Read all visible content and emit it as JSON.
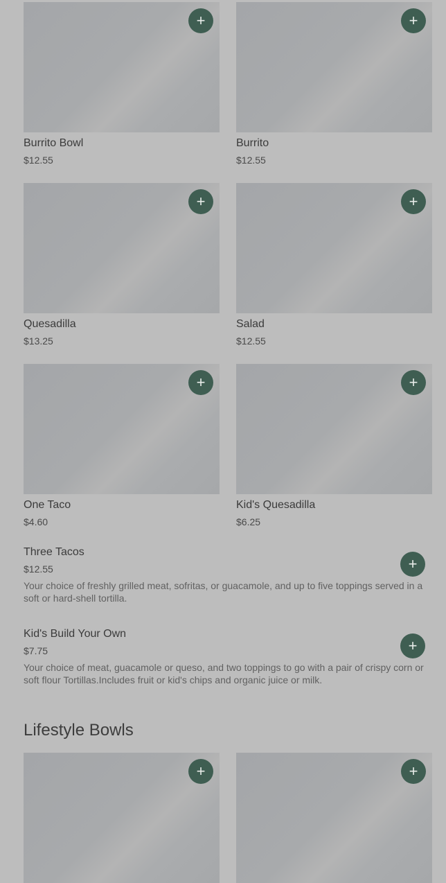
{
  "add_icon": "plus-icon",
  "accent_color": "#3f5e52",
  "grid_rows": [
    [
      {
        "name": "Burrito Bowl",
        "price": "$12.55"
      },
      {
        "name": "Burrito",
        "price": "$12.55"
      }
    ],
    [
      {
        "name": "Quesadilla",
        "price": "$13.25"
      },
      {
        "name": "Salad",
        "price": "$12.55"
      }
    ],
    [
      {
        "name": "One Taco",
        "price": "$4.60"
      },
      {
        "name": "Kid's Quesadilla",
        "price": "$6.25"
      }
    ]
  ],
  "list_items": [
    {
      "name": "Three Tacos",
      "price": "$12.55",
      "description": "Your choice of freshly grilled meat, sofritas, or guacamole, and up to five toppings served in a soft or hard-shell tortilla."
    },
    {
      "name": "Kid's Build Your Own",
      "price": "$7.75",
      "description": "Your choice of meat, guacamole or queso, and two toppings to go with a pair of crispy corn or soft flour Tortillas.Includes fruit or kid's chips and organic juice or milk."
    }
  ],
  "sections": {
    "lifestyle_bowls_title": "Lifestyle Bowls"
  },
  "plus_glyph": "+"
}
